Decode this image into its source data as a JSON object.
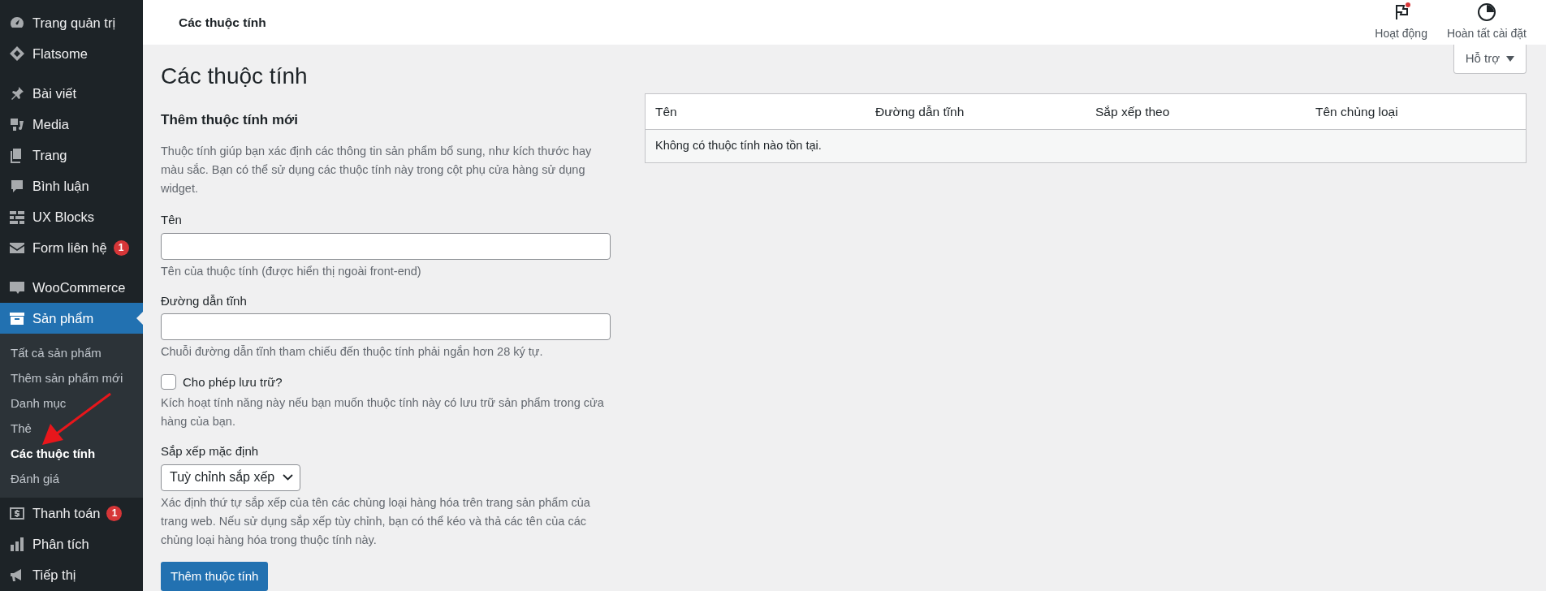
{
  "sidebar": {
    "groups": [
      {
        "items": [
          {
            "label": "Trang quản trị",
            "selected": false
          },
          {
            "label": "Flatsome",
            "selected": false
          }
        ]
      },
      {
        "items": [
          {
            "label": "Bài viết",
            "selected": false
          },
          {
            "label": "Media",
            "selected": false
          },
          {
            "label": "Trang",
            "selected": false
          },
          {
            "label": "Bình luận",
            "selected": false
          },
          {
            "label": "UX Blocks",
            "selected": false
          },
          {
            "label": "Form liên hệ",
            "selected": false,
            "badge": "1"
          }
        ]
      },
      {
        "items": [
          {
            "label": "WooCommerce",
            "selected": false
          },
          {
            "label": "Sản phẩm",
            "selected": true,
            "children": [
              {
                "label": "Tất cả sản phẩm",
                "selected": false
              },
              {
                "label": "Thêm sản phẩm mới",
                "selected": false
              },
              {
                "label": "Danh mục",
                "selected": false
              },
              {
                "label": "Thẻ",
                "selected": false
              },
              {
                "label": "Các thuộc tính",
                "selected": true
              },
              {
                "label": "Đánh giá",
                "selected": false
              }
            ]
          },
          {
            "label": "Thanh toán",
            "selected": false,
            "badge": "1"
          },
          {
            "label": "Phân tích",
            "selected": false
          },
          {
            "label": "Tiếp thị",
            "selected": false
          }
        ]
      }
    ]
  },
  "header": {
    "title": "Các thuộc tính",
    "actions": [
      {
        "label": "Hoạt động",
        "notification": true
      },
      {
        "label": "Hoàn tất cài đặt",
        "notification": false
      }
    ]
  },
  "help_button": "Hỗ trợ",
  "page_title": "Các thuộc tính",
  "form": {
    "heading": "Thêm thuộc tính mới",
    "description": "Thuộc tính giúp bạn xác định các thông tin sản phẩm bổ sung, như kích thước hay màu sắc. Bạn có thể sử dụng các thuộc tính này trong cột phụ cửa hàng sử dụng widget.",
    "fields": [
      {
        "kind": "text",
        "label": "Tên",
        "hint": "Tên của thuộc tính (được hiển thị ngoài front-end)"
      },
      {
        "kind": "text",
        "label": "Đường dẫn tĩnh",
        "hint": "Chuỗi đường dẫn tĩnh tham chiếu đến thuộc tính phải ngắn hơn 28 ký tự."
      },
      {
        "kind": "checkbox",
        "label": "Cho phép lưu trữ?",
        "checked": false,
        "hint": "Kích hoạt tính năng này nếu bạn muốn thuộc tính này có lưu trữ sản phẩm trong cửa hàng của bạn."
      },
      {
        "kind": "select",
        "label": "Sắp xếp mặc định",
        "value": "Tuỳ chỉnh sắp xếp",
        "hint": "Xác định thứ tự sắp xếp của tên các chủng loại hàng hóa trên trang sản phẩm của trang web. Nếu sử dụng sắp xếp tùy chỉnh, bạn có thể kéo và thả các tên của các chủng loại hàng hóa trong thuộc tính này."
      }
    ],
    "submit": "Thêm thuộc tính"
  },
  "table": {
    "columns": [
      "Tên",
      "Đường dẫn tĩnh",
      "Sắp xếp theo",
      "Tên chủng loại"
    ],
    "empty_message": "Không có thuộc tính nào tồn tại."
  }
}
